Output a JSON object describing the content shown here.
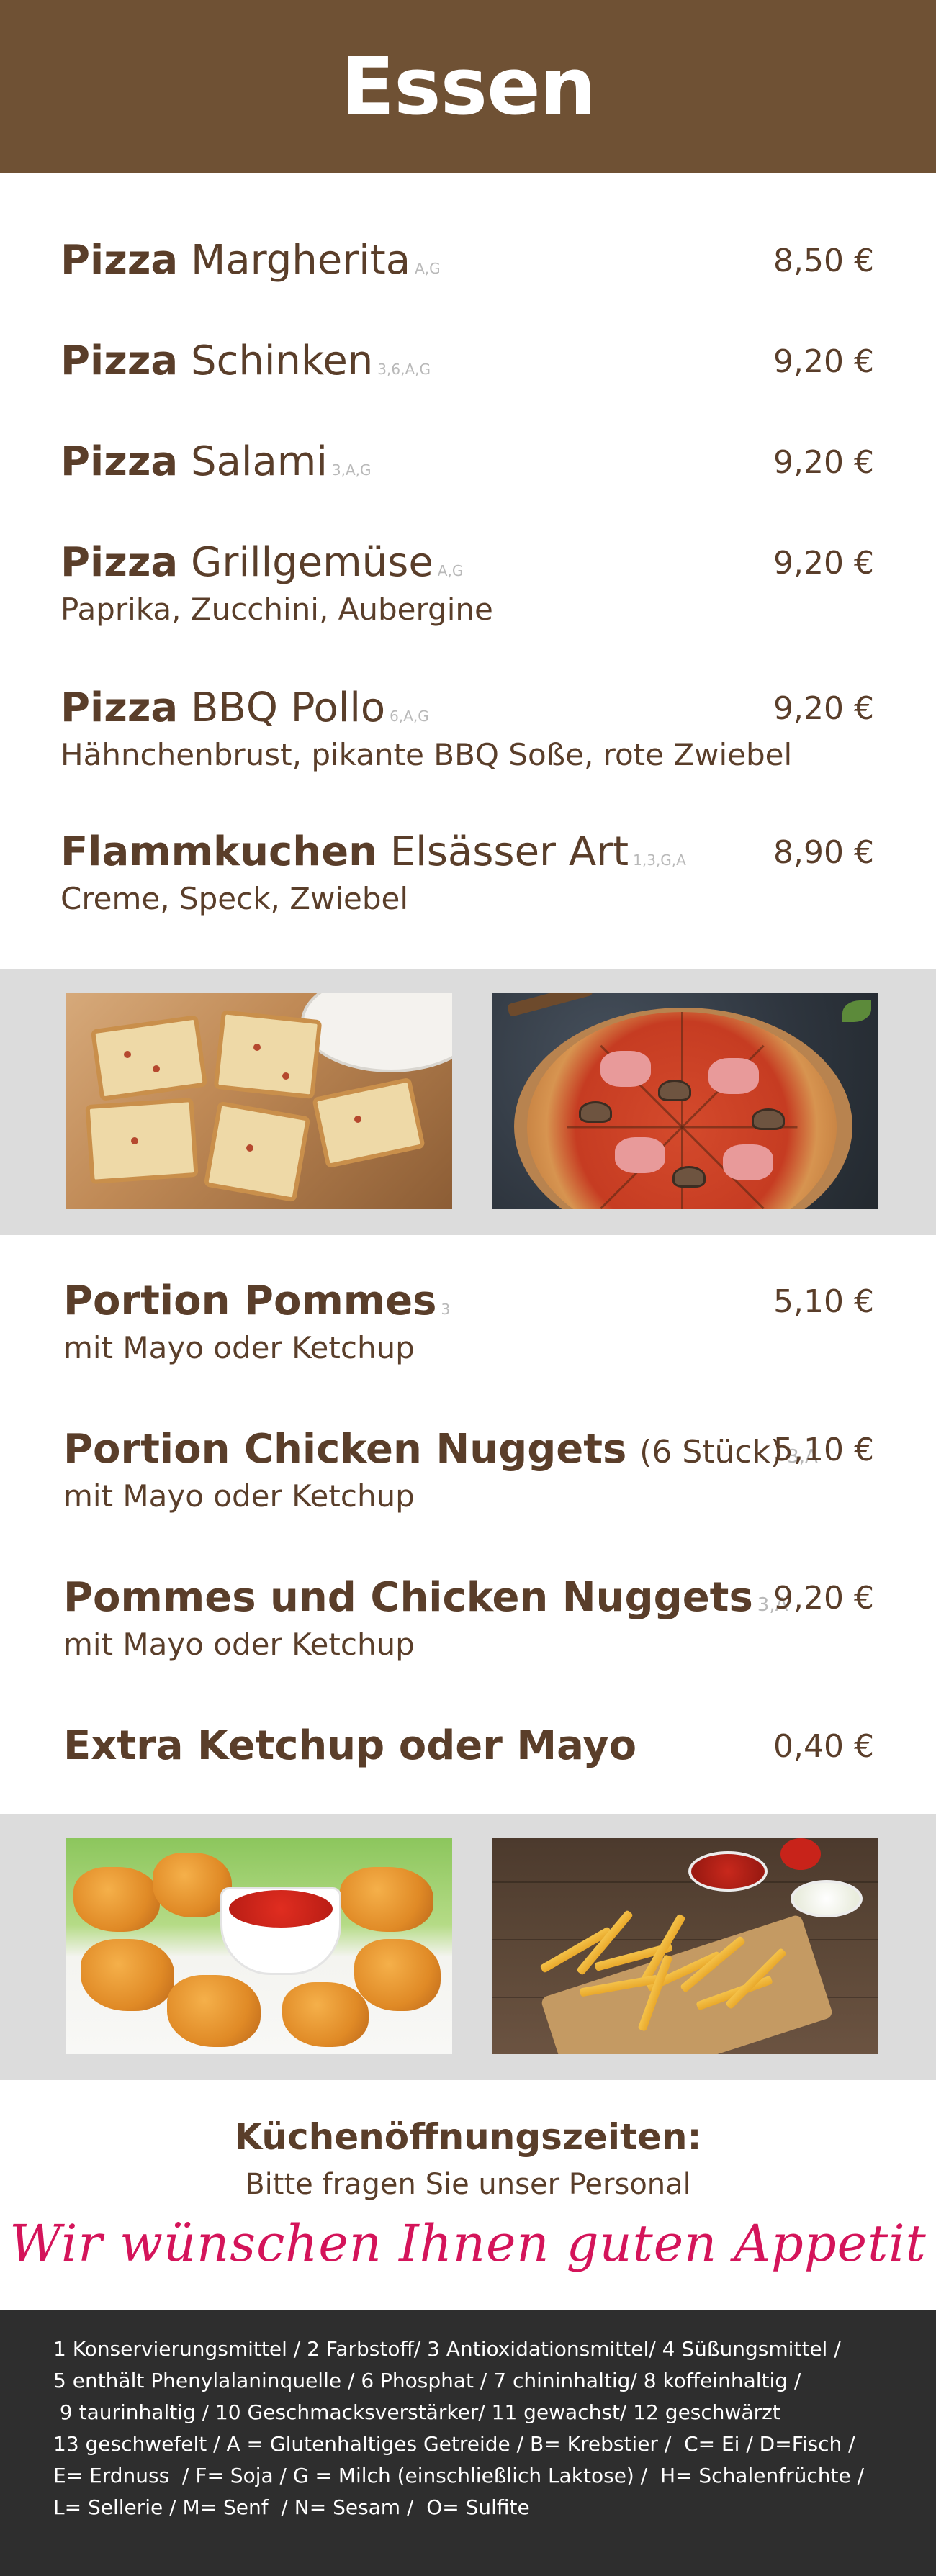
{
  "header": {
    "title": "Essen"
  },
  "pizza_items": [
    {
      "bold": "Pizza",
      "name": "Margherita",
      "allergens": "A,G",
      "price": "8,50 €",
      "desc": ""
    },
    {
      "bold": "Pizza",
      "name": "Schinken",
      "allergens": "3,6,A,G",
      "price": "9,20 €",
      "desc": ""
    },
    {
      "bold": "Pizza",
      "name": "Salami",
      "allergens": "3,A,G",
      "price": "9,20 €",
      "desc": ""
    },
    {
      "bold": "Pizza",
      "name": "Grillgemüse",
      "allergens": "A,G",
      "price": "9,20 €",
      "desc": "Paprika, Zucchini, Aubergine"
    },
    {
      "bold": "Pizza",
      "name": "BBQ Pollo",
      "allergens": "6,A,G",
      "price": "9,20 €",
      "desc": "Hähnchenbrust, pikante BBQ Soße, rote Zwiebel"
    },
    {
      "bold": "Flammkuchen",
      "name": "Elsässer Art",
      "allergens": "1,3,G,A",
      "price": "8,90 €",
      "desc": "Creme, Speck, Zwiebel"
    }
  ],
  "snack_items": [
    {
      "bold": "Portion Pommes",
      "name": "",
      "allergens": "3",
      "price": "5,10 €",
      "desc": "mit Mayo oder Ketchup"
    },
    {
      "bold": "Portion Chicken Nuggets",
      "name": "(6 Stück)",
      "allergens": "3,A",
      "price": "5,10 €",
      "desc": "mit Mayo oder Ketchup"
    },
    {
      "bold": "Pommes und Chicken Nuggets",
      "name": "",
      "allergens": "3,A",
      "price": "9,20 €",
      "desc": "mit Mayo oder Ketchup"
    },
    {
      "bold": "Extra Ketchup oder Mayo",
      "name": "",
      "allergens": "",
      "price": "0,40 €",
      "desc": ""
    }
  ],
  "photos": [
    "flammkuchen-photo",
    "pizza-photo",
    "chicken-nuggets-photo",
    "fries-photo"
  ],
  "hours": {
    "title": "Küchenöffnungszeiten:",
    "subtitle": "Bitte fragen Sie unser Personal",
    "wish": "Wir wünschen Ihnen guten Appetit"
  },
  "footer": {
    "legend": "1 Konservierungsmittel / 2 Farbstoff/ 3 Antioxidationsmittel/ 4 Süßungsmittel /\n5 enthält Phenylalaninquelle / 6 Phosphat / 7 chininhaltig/ 8 koffeinhaltig /\n 9 taurinhaltig / 10 Geschmacksverstärker/ 11 gewachst/ 12 geschwärzt\n13 geschwefelt / A = Glutenhaltiges Getreide / B= Krebstier /  C= Ei / D=Fisch /\nE= Erdnuss  / F= Soja / G = Milch (einschließlich Laktose) /  H= Schalenfrüchte /\nL= Sellerie / M= Senf  / N= Sesam /  O= Sulfite"
  },
  "colors": {
    "brown": "#6f5134",
    "text": "#5a3e2a",
    "band": "#dcdcdc",
    "wish": "#d4145a",
    "footer": "#2e2e2e"
  }
}
